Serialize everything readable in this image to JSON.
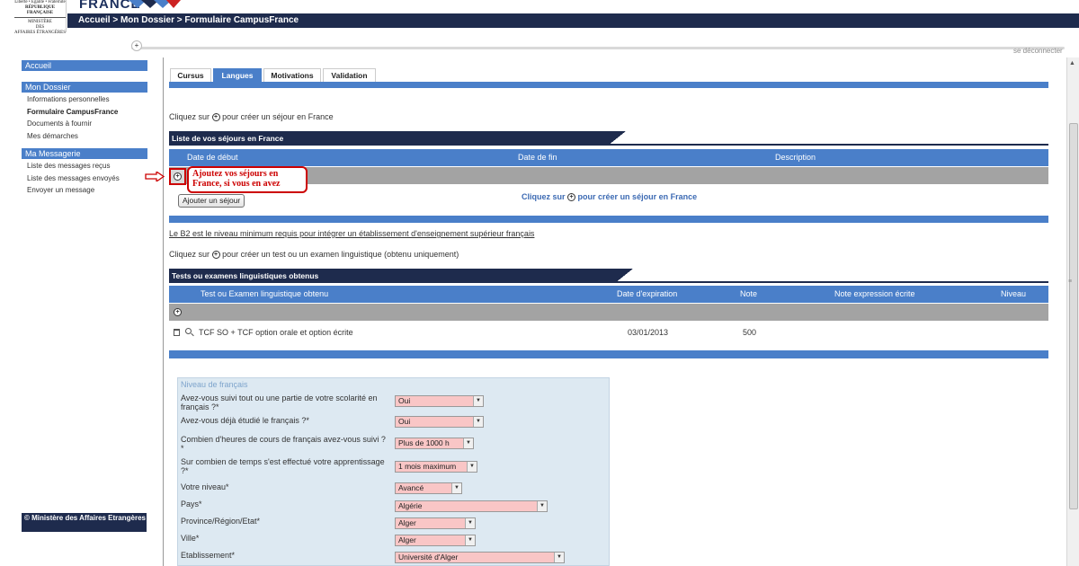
{
  "header": {
    "gov_logo_lines": [
      "Liberté • Égalité • Fraternité",
      "RÉPUBLIQUE FRANÇAISE",
      "MINISTÈRE",
      "DES",
      "AFFAIRES ÉTRANGÈRES"
    ],
    "brand": "FRANCE",
    "breadcrumb": "Accueil > Mon Dossier > Formulaire CampusFrance",
    "logout": "se déconnecter",
    "subbar_plus": "+"
  },
  "sidebar": {
    "accueil": "Accueil",
    "dossier_title": "Mon Dossier",
    "dossier_items": [
      "Informations personnelles",
      "Formulaire CampusFrance",
      "Documents à fournir",
      "Mes démarches"
    ],
    "messagerie_title": "Ma Messagerie",
    "messagerie_items": [
      "Liste des messages reçus",
      "Liste des messages envoyés",
      "Envoyer un message"
    ],
    "footer": "© Ministère des Affaires Etrangères"
  },
  "tabs": [
    "Cursus",
    "Langues",
    "Motivations",
    "Validation"
  ],
  "active_tab": "Langues",
  "sejours": {
    "hint_before": "Cliquez sur",
    "hint_after": "pour créer un séjour en France",
    "title": "Liste de vos séjours en France",
    "columns": [
      "Date de début",
      "Date de fin",
      "Description"
    ],
    "annotation": "Ajoutez vos séjours  en France, si vous en avez",
    "add_button": "Ajouter un séjour",
    "center_link_before": "Cliquez sur",
    "center_link_after": "pour créer un séjour en France"
  },
  "b2_note": "Le B2 est le niveau minimum requis pour intégrer un établissement d'enseignement supérieur français",
  "tests": {
    "hint_before": "Cliquez sur",
    "hint_after": "pour créer un test ou un examen linguistique (obtenu uniquement)",
    "title": "Tests ou examens linguistiques obtenus",
    "columns": [
      "Test ou Examen linguistique obtenu",
      "Date d'expiration",
      "Note",
      "Note expression écrite",
      "Niveau"
    ],
    "rows": [
      {
        "name": "TCF SO + TCF option orale et option écrite",
        "expiration": "03/01/2013",
        "note": "500",
        "note_ecrite": "",
        "niveau": ""
      }
    ]
  },
  "form": {
    "legend": "Niveau de français",
    "fields": [
      {
        "label": "Avez-vous suivi tout ou une partie de votre scolarité en français ?*",
        "value": "Oui"
      },
      {
        "label": "Avez-vous déjà étudié le français ?*",
        "value": "Oui"
      },
      {
        "label": "Combien d'heures de cours de français avez-vous suivi ? *",
        "value": "Plus de 1000 h"
      },
      {
        "label": "Sur combien de temps s'est effectué votre apprentissage ?*",
        "value": "1 mois maximum"
      },
      {
        "label": "Votre niveau*",
        "value": "Avancé"
      },
      {
        "label": "Pays*",
        "value": "Algérie"
      },
      {
        "label": "Province/Région/Etat*",
        "value": "Alger"
      },
      {
        "label": "Ville*",
        "value": "Alger"
      },
      {
        "label": "Etablissement*",
        "value": "Université d'Alger"
      }
    ]
  },
  "colors": {
    "navy": "#1e2b4d",
    "blue": "#4a7fc9",
    "select_bg": "#f9c6c6",
    "form_bg": "#dde9f2",
    "annotation": "#cc0000"
  }
}
